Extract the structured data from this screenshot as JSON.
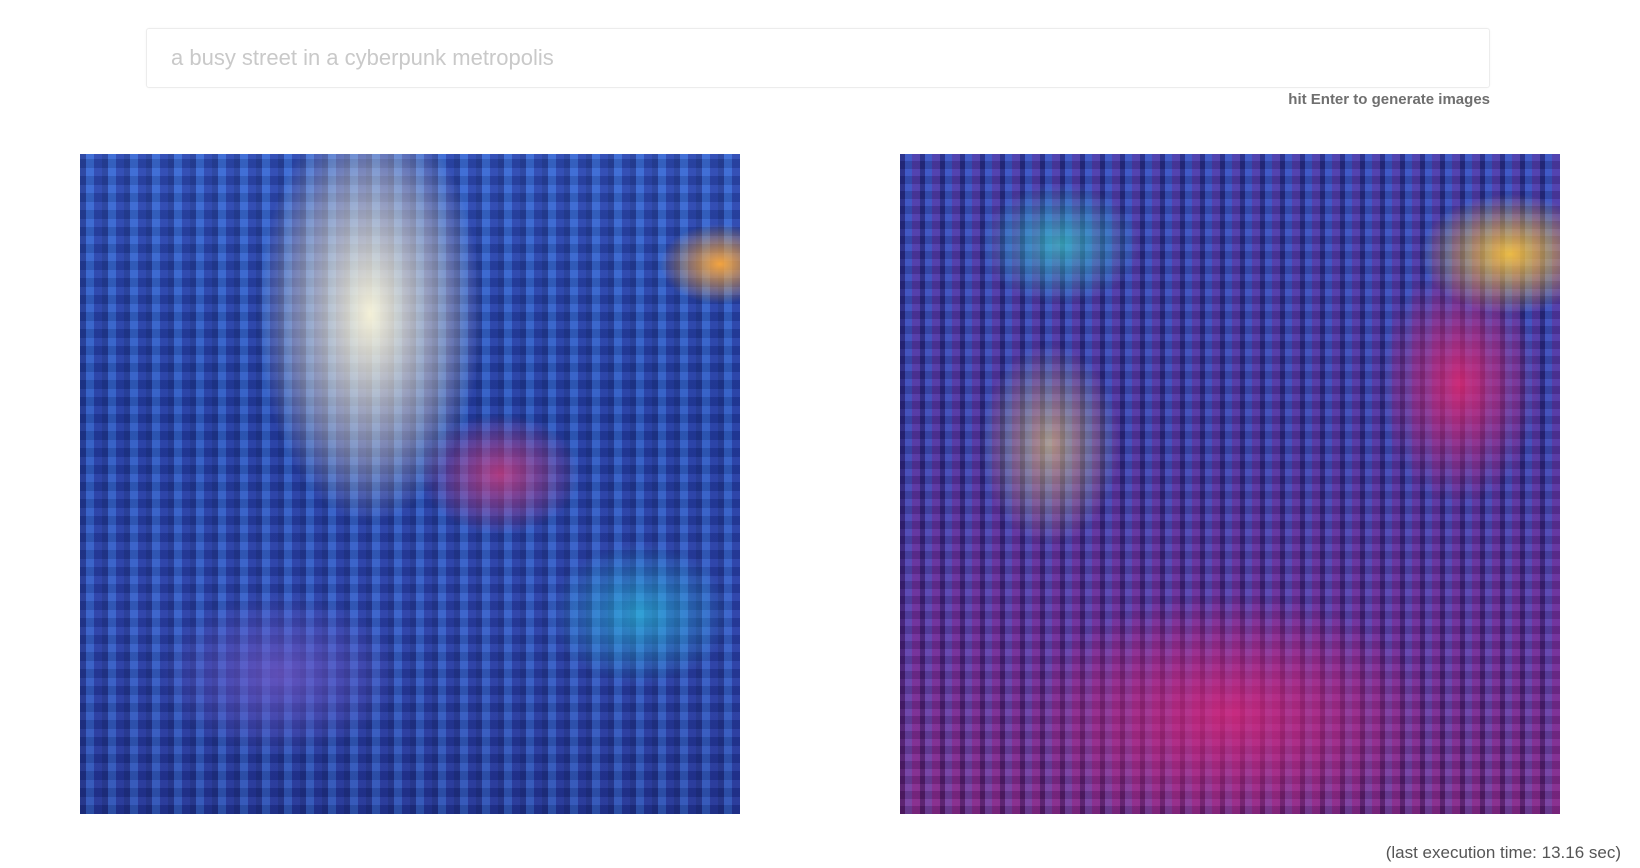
{
  "prompt": {
    "placeholder": "a busy street in a cyberpunk metropolis",
    "value": ""
  },
  "hint_text": "hit Enter to generate images",
  "results": [
    {
      "image": "generated-image-1"
    },
    {
      "image": "generated-image-2"
    }
  ],
  "footer": {
    "execution_time_text": "(last execution time: 13.16 sec)"
  }
}
